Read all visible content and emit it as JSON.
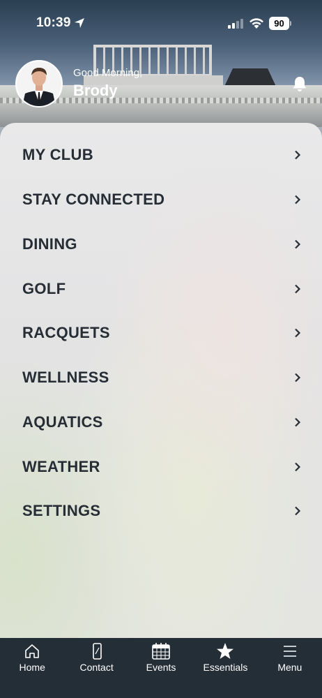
{
  "status_bar": {
    "time": "10:39",
    "battery": "90"
  },
  "header": {
    "greeting": "Good Morning,",
    "user_name": "Brody"
  },
  "menu": {
    "items": [
      {
        "label": "MY CLUB"
      },
      {
        "label": "STAY CONNECTED"
      },
      {
        "label": "DINING"
      },
      {
        "label": "GOLF"
      },
      {
        "label": "RACQUETS"
      },
      {
        "label": "WELLNESS"
      },
      {
        "label": "AQUATICS"
      },
      {
        "label": "WEATHER"
      },
      {
        "label": "SETTINGS"
      }
    ]
  },
  "tabs": [
    {
      "label": "Home",
      "icon": "home-icon"
    },
    {
      "label": "Contact",
      "icon": "phone-icon"
    },
    {
      "label": "Events",
      "icon": "calendar-icon"
    },
    {
      "label": "Essentials",
      "icon": "star-icon"
    },
    {
      "label": "Menu",
      "icon": "hamburger-icon"
    }
  ],
  "colors": {
    "tab_bar": "#242e37",
    "menu_text": "#262d35",
    "panel": "#e6e6e7"
  }
}
